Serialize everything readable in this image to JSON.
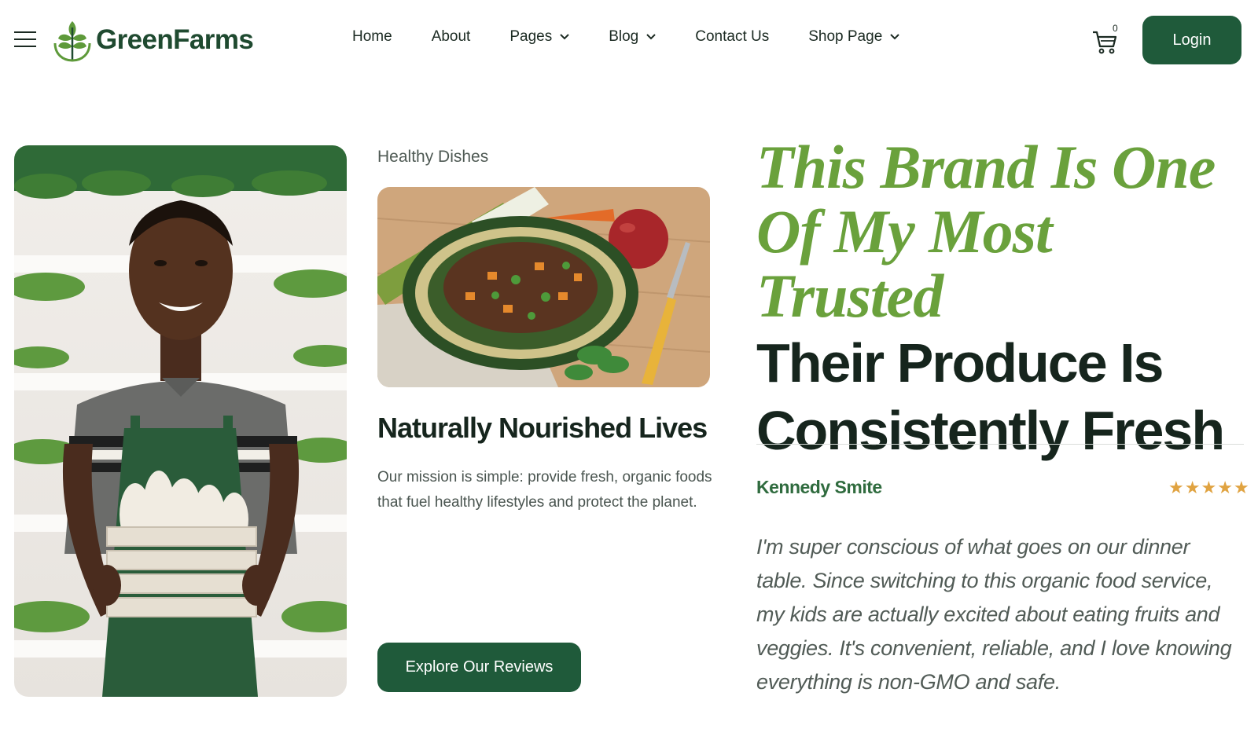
{
  "brand": {
    "name": "GreenFarms",
    "color": "#1f4a30",
    "accent": "#6aa13c"
  },
  "nav": {
    "items": [
      {
        "label": "Home",
        "has_dropdown": false
      },
      {
        "label": "About",
        "has_dropdown": false
      },
      {
        "label": "Pages",
        "has_dropdown": true
      },
      {
        "label": "Blog",
        "has_dropdown": true
      },
      {
        "label": "Contact Us",
        "has_dropdown": false
      },
      {
        "label": "Shop Page",
        "has_dropdown": true
      }
    ],
    "cart_count": "0",
    "login_label": "Login",
    "menu_icon": "hamburger-icon",
    "cart_icon": "cart-icon"
  },
  "card": {
    "eyebrow": "Healthy Dishes",
    "title": "Naturally Nourished Lives",
    "description": "Our mission is simple: provide fresh, organic foods that fuel healthy lifestyles and protect the planet.",
    "button_label": "Explore Our Reviews"
  },
  "testimonial": {
    "heading_italic_1": "This Brand Is One",
    "heading_italic_2": "Of My Most Trusted",
    "heading_solid_1": "Their Produce Is",
    "heading_solid_2": "Consistently Fresh",
    "reviewer": "Kennedy Smite",
    "rating": 5,
    "rating_max": 5,
    "quote": "I'm super conscious of what goes on our dinner table. Since switching to this organic food service, my kids are actually excited about eating fruits and veggies. It's convenient, reliable, and I love knowing everything is non-GMO and safe."
  },
  "colors": {
    "primary_button": "#1f5a3a",
    "star": "#e0a341",
    "text_dark": "#16251d"
  }
}
